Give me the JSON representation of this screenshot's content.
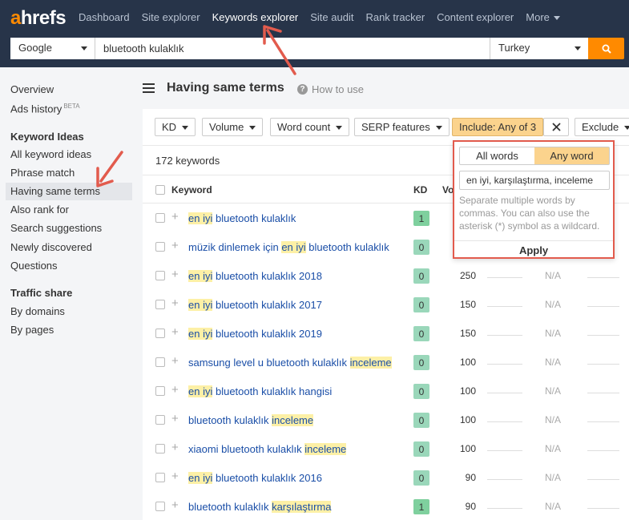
{
  "logo": {
    "a": "a",
    "rest": "hrefs"
  },
  "nav": [
    {
      "label": "Dashboard",
      "active": false
    },
    {
      "label": "Site explorer",
      "active": false
    },
    {
      "label": "Keywords explorer",
      "active": true
    },
    {
      "label": "Site audit",
      "active": false
    },
    {
      "label": "Rank tracker",
      "active": false
    },
    {
      "label": "Content explorer",
      "active": false
    }
  ],
  "nav_more": "More",
  "search": {
    "engine": "Google",
    "query": "bluetooth kulaklık",
    "country": "Turkey",
    "icon": "search-icon"
  },
  "sidebar": {
    "overview": "Overview",
    "ads_history": "Ads history",
    "beta": "BETA",
    "keyword_ideas_head": "Keyword Ideas",
    "ideas": [
      "All keyword ideas",
      "Phrase match",
      "Having same terms",
      "Also rank for",
      "Search suggestions",
      "Newly discovered",
      "Questions"
    ],
    "traffic_head": "Traffic share",
    "traffic": [
      "By domains",
      "By pages"
    ]
  },
  "page": {
    "title": "Having same terms",
    "how_to": "How to use"
  },
  "filters": {
    "kd": "KD",
    "volume": "Volume",
    "word_count": "Word count",
    "serp": "SERP features",
    "include": "Include: Any of 3",
    "exclude": "Exclude"
  },
  "count": "172 keywords",
  "columns": {
    "keyword": "Keyword",
    "kd": "KD",
    "volume": "Vo"
  },
  "rows": [
    {
      "parts": [
        [
          "en iyi",
          true
        ],
        [
          " bluetooth kulaklık",
          false
        ]
      ],
      "kd": "1",
      "volume": "",
      "na": ""
    },
    {
      "parts": [
        [
          "müzik dinlemek için ",
          false
        ],
        [
          "en iyi",
          true
        ],
        [
          " bluetooth kulaklık",
          false
        ]
      ],
      "kd": "0",
      "volume": "",
      "na": ""
    },
    {
      "parts": [
        [
          "en iyi",
          true
        ],
        [
          " bluetooth kulaklık 2018",
          false
        ]
      ],
      "kd": "0",
      "volume": "250",
      "na": "N/A"
    },
    {
      "parts": [
        [
          "en iyi",
          true
        ],
        [
          " bluetooth kulaklık 2017",
          false
        ]
      ],
      "kd": "0",
      "volume": "150",
      "na": "N/A"
    },
    {
      "parts": [
        [
          "en iyi",
          true
        ],
        [
          " bluetooth kulaklık 2019",
          false
        ]
      ],
      "kd": "0",
      "volume": "150",
      "na": "N/A"
    },
    {
      "parts": [
        [
          "samsung level u bluetooth kulaklık ",
          false
        ],
        [
          "inceleme",
          true
        ]
      ],
      "kd": "0",
      "volume": "100",
      "na": "N/A"
    },
    {
      "parts": [
        [
          "en iyi",
          true
        ],
        [
          " bluetooth kulaklık hangisi",
          false
        ]
      ],
      "kd": "0",
      "volume": "100",
      "na": "N/A"
    },
    {
      "parts": [
        [
          "bluetooth kulaklık ",
          false
        ],
        [
          "inceleme",
          true
        ]
      ],
      "kd": "0",
      "volume": "100",
      "na": "N/A"
    },
    {
      "parts": [
        [
          "xiaomi bluetooth kulaklık ",
          false
        ],
        [
          "inceleme",
          true
        ]
      ],
      "kd": "0",
      "volume": "100",
      "na": "N/A"
    },
    {
      "parts": [
        [
          "en iyi",
          true
        ],
        [
          " bluetooth kulaklık 2016",
          false
        ]
      ],
      "kd": "0",
      "volume": "90",
      "na": "N/A"
    },
    {
      "parts": [
        [
          "bluetooth kulaklık ",
          false
        ],
        [
          "karşılaştırma",
          true
        ]
      ],
      "kd": "1",
      "volume": "90",
      "na": "N/A"
    }
  ],
  "kd_colors": {
    "0": "#9ad7ba",
    "1": "#7fd09e"
  },
  "popup": {
    "all_words": "All words",
    "any_word": "Any word",
    "value": "en iyi, karşılaştırma, inceleme",
    "hint": "Separate multiple words by commas. You can also use the asterisk (*) symbol as a wildcard.",
    "apply": "Apply"
  },
  "colors": {
    "accent": "#ff8a00",
    "nav_bg": "#273449",
    "highlight": "#fdf0a6",
    "annotation": "#e25b4d"
  }
}
